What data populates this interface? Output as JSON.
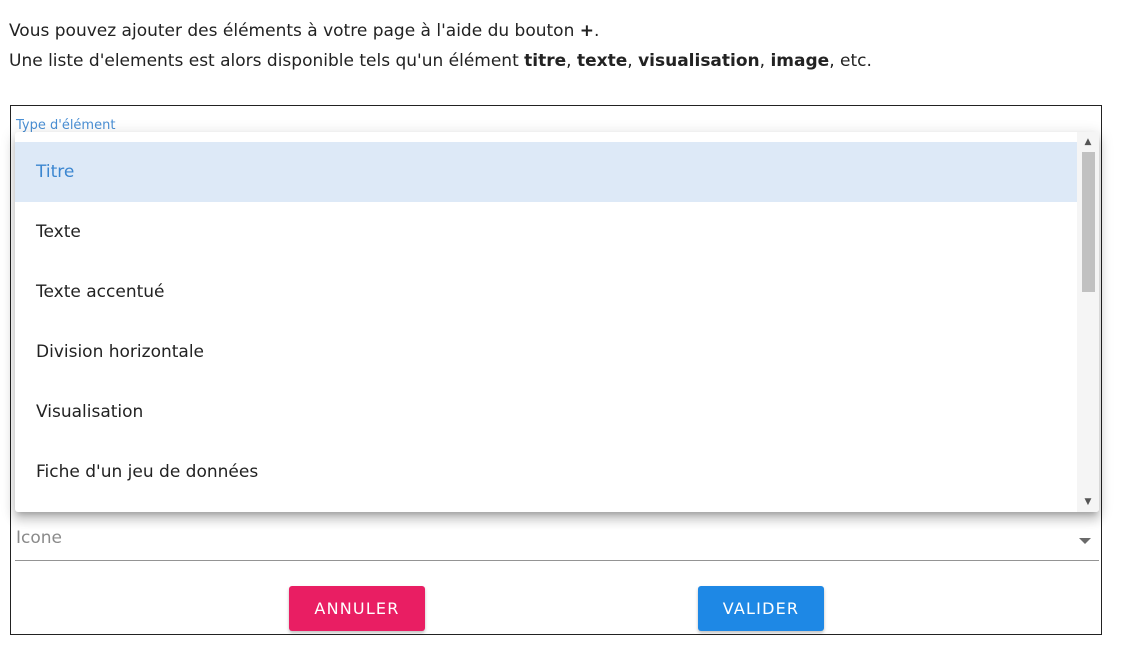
{
  "intro": {
    "line1_text": "Vous pouvez ajouter des éléments à votre page à l'aide du bouton ",
    "line1_bold": "+",
    "line1_end": ".",
    "line2_text": "Une liste d'elements est alors disponible tels qu'un élément ",
    "line2_items": [
      "titre",
      "texte",
      "visualisation",
      "image"
    ],
    "line2_sep": ", ",
    "line2_end": ", etc."
  },
  "dialog": {
    "field_label": "Type d'élément",
    "options": [
      {
        "label": "Titre",
        "selected": true
      },
      {
        "label": "Texte",
        "selected": false
      },
      {
        "label": "Texte accentué",
        "selected": false
      },
      {
        "label": "Division horizontale",
        "selected": false
      },
      {
        "label": "Visualisation",
        "selected": false
      },
      {
        "label": "Fiche d'un jeu de données",
        "selected": false
      }
    ],
    "icon_field_label": "Icone",
    "cancel_label": "ANNULER",
    "validate_label": "VALIDER"
  },
  "colors": {
    "accent": "#1e88e5",
    "cancel": "#e91e63",
    "selected_bg": "#dde9f7",
    "selected_text": "#3b86d0"
  },
  "icons": {
    "scroll_up": "scroll-up-arrow",
    "scroll_down": "scroll-down-arrow",
    "select_caret": "chevron-down-icon"
  }
}
